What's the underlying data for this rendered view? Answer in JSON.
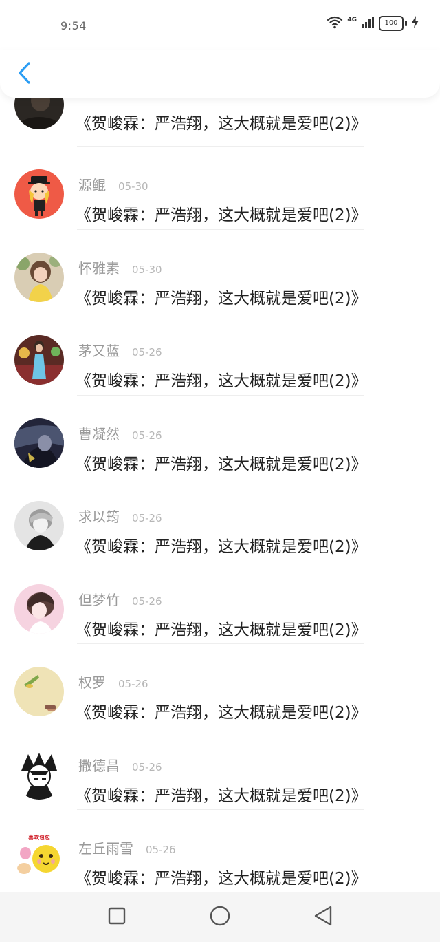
{
  "status_bar": {
    "time": "9:54",
    "network": "4G",
    "battery": "100"
  },
  "icons": {
    "back": "chevron-left-icon",
    "wifi": "wifi-icon",
    "signal": "signal-icon",
    "charging": "bolt-icon",
    "home": "circle-icon",
    "recents": "square-icon",
    "back_nav": "triangle-left-icon"
  },
  "colors": {
    "accent": "#2a9df4",
    "name": "#9a9a9a",
    "date": "#b6b6b6",
    "title": "#222222",
    "divider": "#eeeeee"
  },
  "items": [
    {
      "name": "",
      "date": "",
      "title": "《贺峻霖：严浩翔，这大概就是爱吧(2)》"
    },
    {
      "name": "源鲲",
      "date": "05-30",
      "title": "《贺峻霖：严浩翔，这大概就是爱吧(2)》"
    },
    {
      "name": "怀雅素",
      "date": "05-30",
      "title": "《贺峻霖：严浩翔，这大概就是爱吧(2)》"
    },
    {
      "name": "茅又蓝",
      "date": "05-26",
      "title": "《贺峻霖：严浩翔，这大概就是爱吧(2)》"
    },
    {
      "name": "曹凝然",
      "date": "05-26",
      "title": "《贺峻霖：严浩翔，这大概就是爱吧(2)》"
    },
    {
      "name": "求以筠",
      "date": "05-26",
      "title": "《贺峻霖：严浩翔，这大概就是爱吧(2)》"
    },
    {
      "name": "但梦竹",
      "date": "05-26",
      "title": "《贺峻霖：严浩翔，这大概就是爱吧(2)》"
    },
    {
      "name": "权罗",
      "date": "05-26",
      "title": "《贺峻霖：严浩翔，这大概就是爱吧(2)》"
    },
    {
      "name": "撒德昌",
      "date": "05-26",
      "title": "《贺峻霖：严浩翔，这大概就是爱吧(2)》"
    },
    {
      "name": "左丘雨雪",
      "date": "05-26",
      "title": "《贺峻霖：严浩翔，这大概就是爱吧(2)》"
    }
  ],
  "avatar_sticker_text": "喜欢包包"
}
